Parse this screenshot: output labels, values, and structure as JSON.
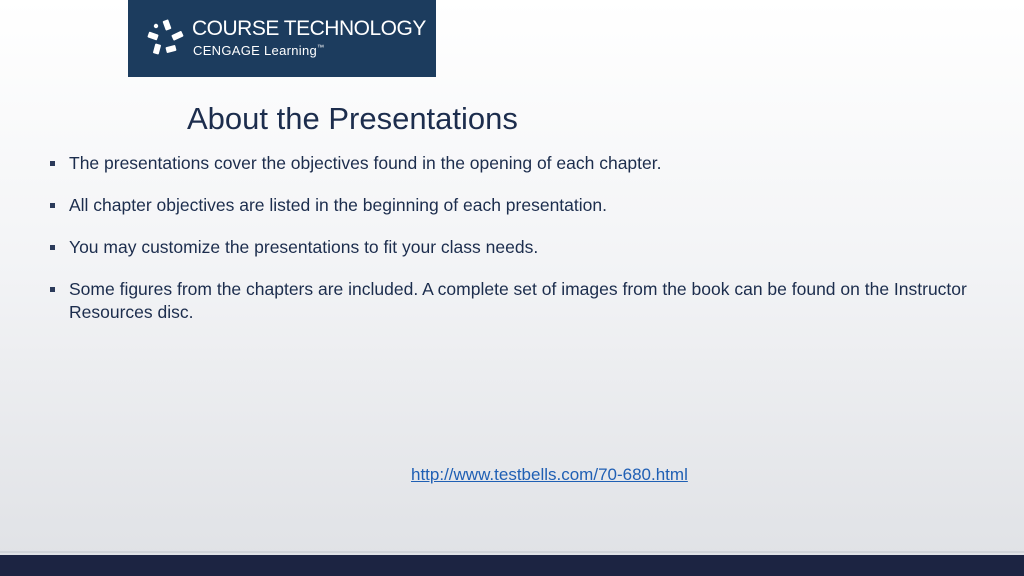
{
  "logo": {
    "line1": "COURSE TECHNOLOGY",
    "line2": "CENGAGE Learning",
    "trademark": "™",
    "background_color": "#1c3c5e"
  },
  "slide": {
    "title": "About the Presentations",
    "bullets": [
      "The presentations cover the objectives found in the opening of each chapter.",
      "All chapter objectives are listed in the beginning of each presentation.",
      "You may customize the presentations to fit your class needs.",
      "Some figures from the chapters are included. A complete set of images from the book can be found on the Instructor Resources disc."
    ],
    "link": "http://www.testbells.com/70-680.html"
  },
  "colors": {
    "text": "#1c2d4d",
    "link": "#1f5fb4",
    "footer_bar": "#1c2442"
  }
}
